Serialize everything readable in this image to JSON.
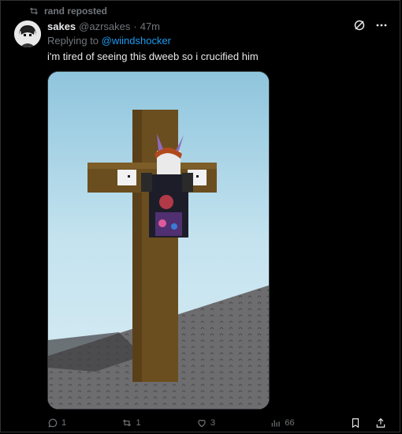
{
  "repost": {
    "label": "rand reposted"
  },
  "tweet": {
    "name": "sakes",
    "handle": "@azrsakes",
    "separator": "·",
    "time": "47m",
    "reply_prefix": "Replying to",
    "reply_mention": "@wiindshocker",
    "text": "i'm tired of seeing this dweeb so i crucified him"
  },
  "actions": {
    "replies": "1",
    "reposts": "1",
    "likes": "3",
    "views": "66"
  },
  "icons": {
    "repost": "repost-icon",
    "grok": "grok-icon",
    "more": "more-icon",
    "reply": "reply-icon",
    "like": "heart-icon",
    "views": "views-icon",
    "bookmark": "bookmark-icon",
    "share": "share-icon"
  },
  "colors": {
    "background": "#000000",
    "text": "#e7e9ea",
    "muted": "#71767b",
    "link": "#1d9bf0"
  }
}
